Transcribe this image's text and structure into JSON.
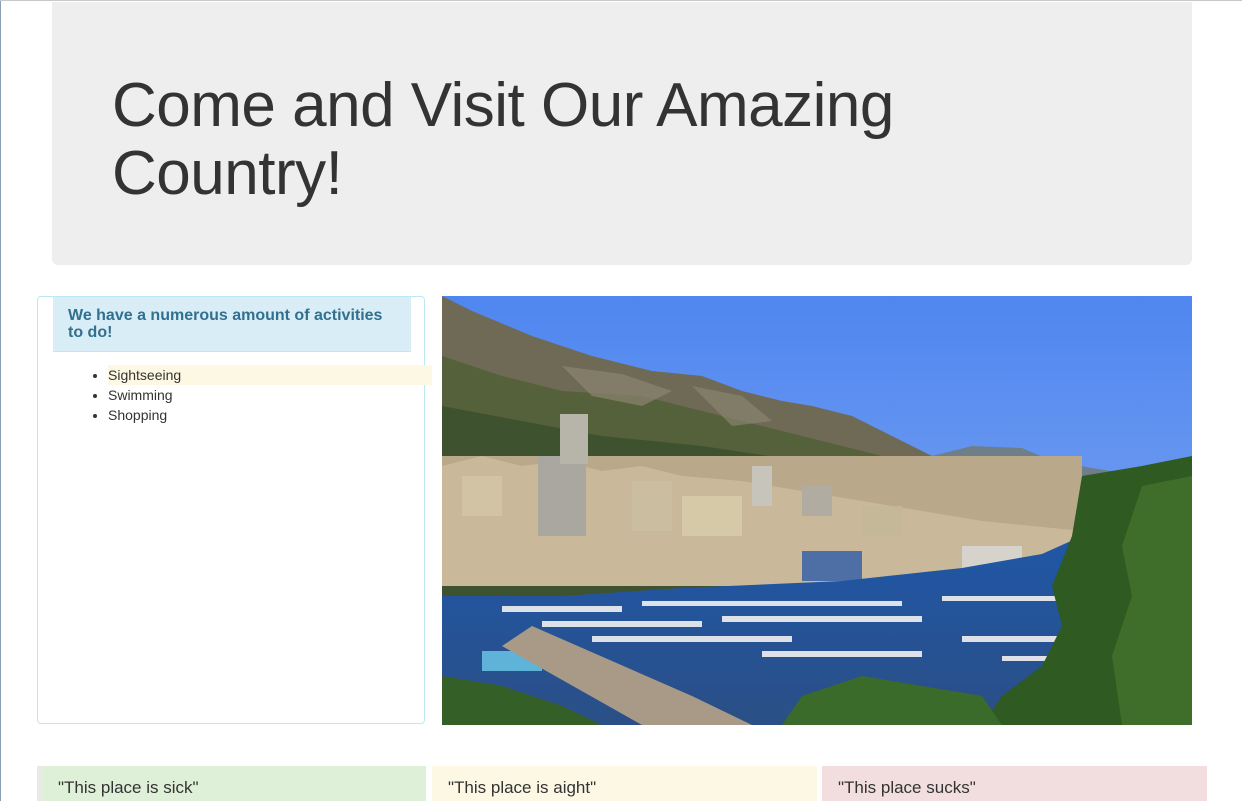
{
  "jumbotron": {
    "title": "Come and Visit Our Amazing Country!"
  },
  "activities": {
    "heading": "We have a numerous amount of activities to do!",
    "items": [
      "Sightseeing",
      "Swimming",
      "Shopping"
    ]
  },
  "hero_image": {
    "subject": "coastal-harbor-city-photo"
  },
  "reviews": [
    {
      "text": "\"This place is sick\"",
      "color": "#dff0d8"
    },
    {
      "text": "\"This place is aight\"",
      "color": "#fcf8e3"
    },
    {
      "text": "\"This place sucks\"",
      "color": "#f2dede"
    }
  ]
}
